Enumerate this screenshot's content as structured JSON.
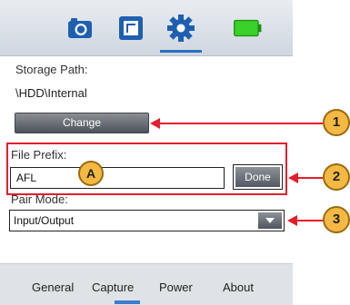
{
  "toolbar": {
    "icons": [
      "camera-icon",
      "capture-icon",
      "gear-icon",
      "battery-icon"
    ],
    "active_tab_icon": "gear-icon"
  },
  "settings": {
    "storage_path_label": "Storage Path:",
    "storage_path_value": "\\HDD\\Internal",
    "change_button": "Change",
    "file_prefix_label": "File Prefix:",
    "file_prefix_value": "AFL",
    "done_button": "Done",
    "pair_mode_label": "Pair Mode:",
    "pair_mode_value": "Input/Output"
  },
  "bottom_tabs": {
    "items": [
      "General",
      "Capture",
      "Power",
      "About"
    ],
    "active": "Capture"
  },
  "callouts": {
    "a": "A",
    "one": "1",
    "two": "2",
    "three": "3"
  },
  "colors": {
    "highlight": "#e31e2d",
    "callout_fill": "#f4b942",
    "accent": "#2a6fc0",
    "battery": "#39d12a"
  }
}
